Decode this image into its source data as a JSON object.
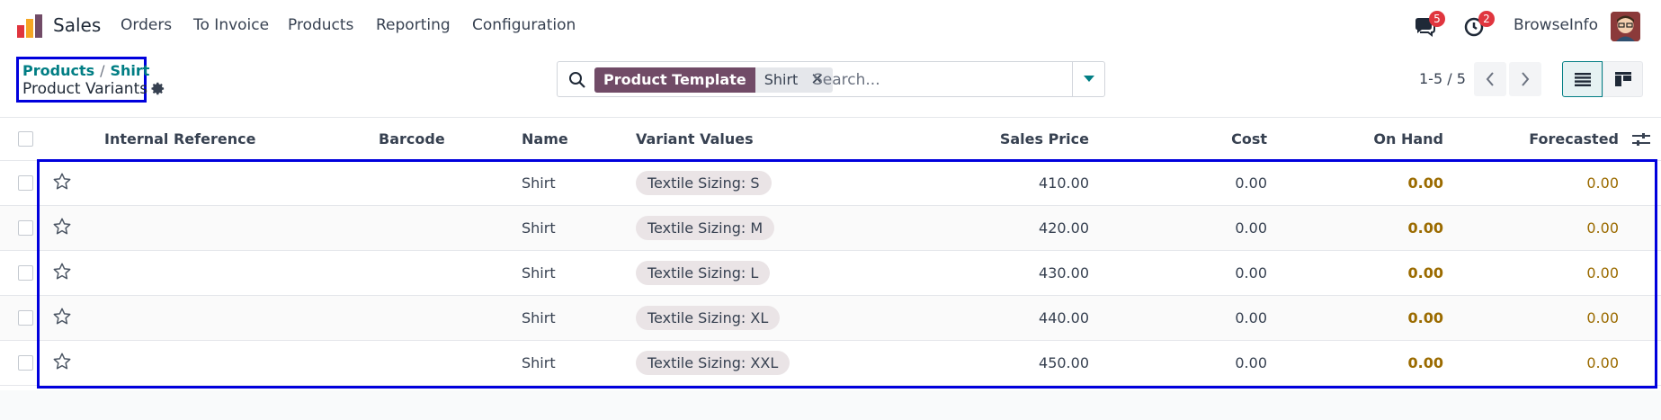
{
  "app": {
    "name": "Sales"
  },
  "menu": [
    "Orders",
    "To Invoice",
    "Products",
    "Reporting",
    "Configuration"
  ],
  "navbar": {
    "messages_count": "5",
    "activities_count": "2",
    "user_name": "BrowseInfo"
  },
  "breadcrumb": {
    "parent": "Products",
    "separator": "/",
    "middle": "Shirt",
    "current": "Product Variants"
  },
  "search": {
    "facet_label": "Product Template",
    "facet_value": "Shirt",
    "facet_close": "✕",
    "placeholder": "Search..."
  },
  "pager": {
    "value": "1-5 / 5"
  },
  "table": {
    "columns": {
      "internal_reference": "Internal Reference",
      "barcode": "Barcode",
      "name": "Name",
      "variant_values": "Variant Values",
      "sales_price": "Sales Price",
      "cost": "Cost",
      "on_hand": "On Hand",
      "forecasted": "Forecasted"
    },
    "rows": [
      {
        "name": "Shirt",
        "variant": "Textile Sizing: S",
        "sales_price": "410.00",
        "cost": "0.00",
        "on_hand": "0.00",
        "forecasted": "0.00"
      },
      {
        "name": "Shirt",
        "variant": "Textile Sizing: M",
        "sales_price": "420.00",
        "cost": "0.00",
        "on_hand": "0.00",
        "forecasted": "0.00"
      },
      {
        "name": "Shirt",
        "variant": "Textile Sizing: L",
        "sales_price": "430.00",
        "cost": "0.00",
        "on_hand": "0.00",
        "forecasted": "0.00"
      },
      {
        "name": "Shirt",
        "variant": "Textile Sizing: XL",
        "sales_price": "440.00",
        "cost": "0.00",
        "on_hand": "0.00",
        "forecasted": "0.00"
      },
      {
        "name": "Shirt",
        "variant": "Textile Sizing: XXL",
        "sales_price": "450.00",
        "cost": "0.00",
        "on_hand": "0.00",
        "forecasted": "0.00"
      }
    ]
  },
  "colors": {
    "brand": "#714b67",
    "link": "#017e84",
    "highlight_box": "#0000dd",
    "badge": "#e0353e",
    "stock_value": "#9b6b00"
  },
  "icons": [
    "sales-app-logo-icon",
    "chat-icon",
    "clock-icon",
    "gear-icon",
    "search-icon",
    "caret-down-icon",
    "chevron-left-icon",
    "chevron-right-icon",
    "list-view-icon",
    "kanban-view-icon",
    "star-icon",
    "optional-columns-icon"
  ]
}
